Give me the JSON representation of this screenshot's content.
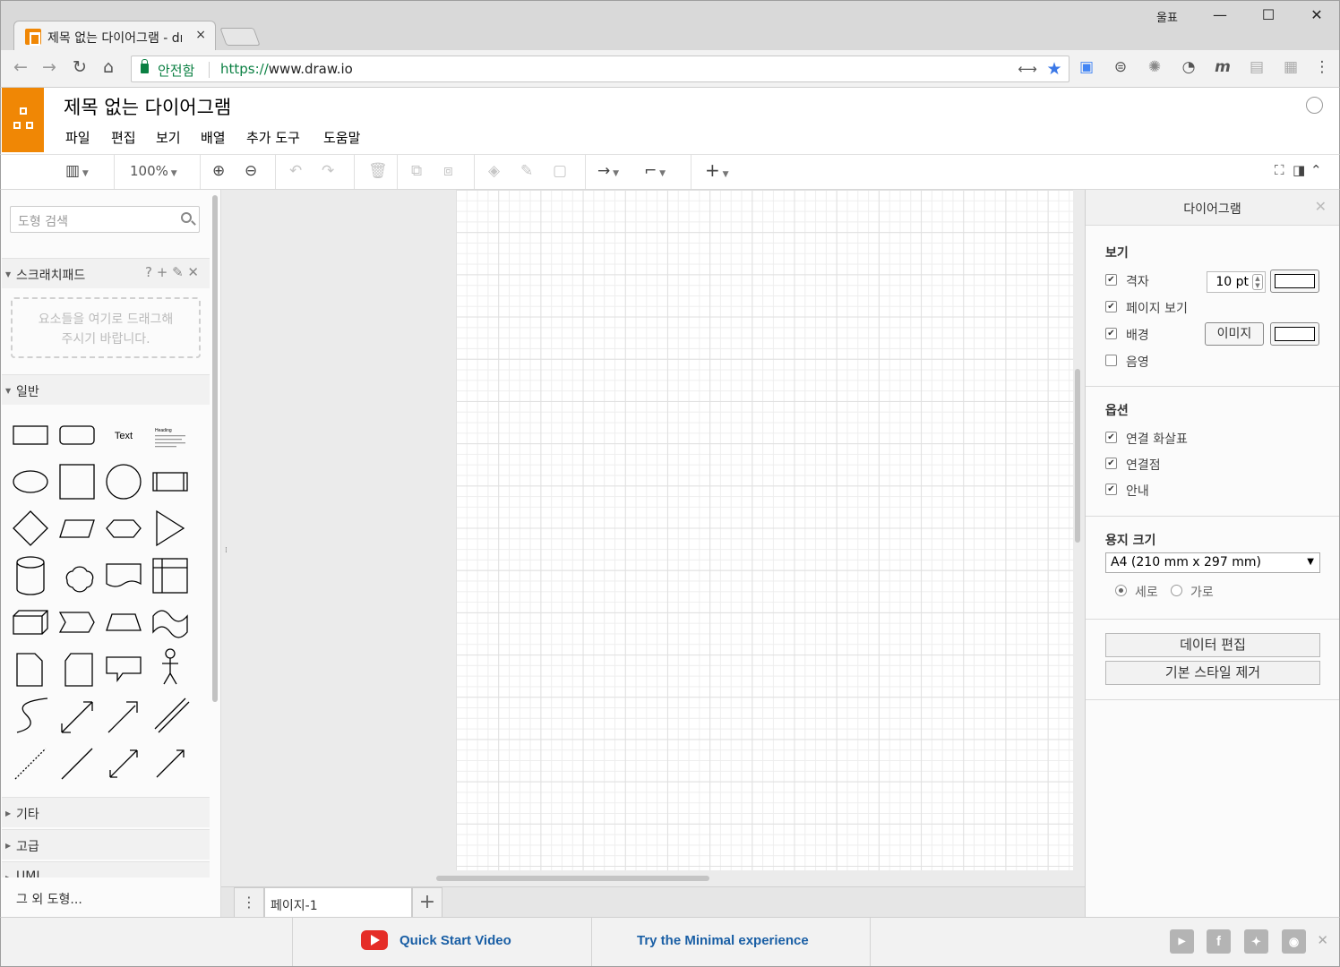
{
  "browser": {
    "tab_title": "제목 없는 다이어그램 - draw.io",
    "tab_close": "×",
    "profile": "울표",
    "win_min": "—",
    "win_max": "☐",
    "win_close": "✕",
    "secure_label": "안전함",
    "url_scheme": "https://",
    "url_rest": "www.draw.io"
  },
  "app": {
    "title": "제목 없는 다이어그램",
    "menus": [
      "파일",
      "편집",
      "보기",
      "배열",
      "추가 도구",
      "도움말"
    ]
  },
  "toolbar": {
    "zoom": "100%"
  },
  "sidebar": {
    "search_placeholder": "도형 검색",
    "scratchpad_label": "스크래치패드",
    "scratchpad_actions": "? + ✎ ✕",
    "dropzone_text_1": "요소들을 여기로 드래그해",
    "dropzone_text_2": "주시기 바랍니다.",
    "general_label": "일반",
    "text_shape": "Text",
    "heading_shape": "Heading",
    "sections": [
      "기타",
      "고급",
      "UML"
    ],
    "more_shapes": "그 외 도형..."
  },
  "pages": {
    "tab_label": "페이지-1",
    "menu_icon": "⋮",
    "add_icon": "+"
  },
  "format": {
    "title": "다이어그램",
    "close": "✕",
    "view_header": "보기",
    "grid_label": "격자",
    "grid_size": "10 pt",
    "page_view_label": "페이지 보기",
    "background_label": "배경",
    "image_button": "이미지",
    "shadow_label": "음영",
    "options_header": "옵션",
    "connection_arrows": "연결 화살표",
    "connection_points": "연결점",
    "guides": "안내",
    "paper_header": "용지 크기",
    "paper_size": "A4 (210 mm x 297 mm)",
    "portrait": "세로",
    "landscape": "가로",
    "edit_data": "데이터 편집",
    "clear_style": "기본 스타일 제거"
  },
  "footer": {
    "quick_start": "Quick Start Video",
    "minimal": "Try the Minimal experience",
    "close": "✕"
  }
}
